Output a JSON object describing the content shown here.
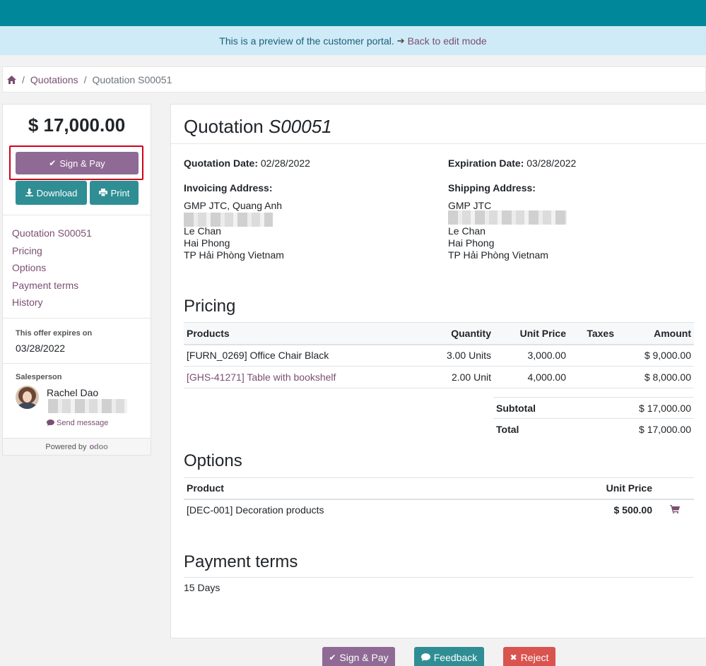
{
  "preview": {
    "message": "This is a preview of the customer portal.",
    "back_link": "Back to edit mode"
  },
  "breadcrumb": {
    "items": [
      "Quotations",
      "Quotation S00051"
    ]
  },
  "sidebar": {
    "amount": "$ 17,000.00",
    "sign_pay": "Sign & Pay",
    "download": "Download",
    "print": "Print",
    "nav": [
      "Quotation S00051",
      "Pricing",
      "Options",
      "Payment terms",
      "History"
    ],
    "expires_label": "This offer expires on",
    "expires_date": "03/28/2022",
    "salesperson_label": "Salesperson",
    "salesperson_name": "Rachel Dao",
    "send_message": "Send message",
    "powered_by": "Powered by",
    "odoo_o": "o",
    "odoo_rest": "doo"
  },
  "quotation": {
    "title_prefix": "Quotation",
    "number": "S00051",
    "date_label": "Quotation Date:",
    "date_value": "02/28/2022",
    "expiration_label": "Expiration Date:",
    "expiration_value": "03/28/2022",
    "invoicing_label": "Invoicing Address:",
    "invoicing_name": "GMP JTC, Quang Anh",
    "invoicing_lines": [
      "Le Chan",
      "Hai Phong",
      "TP Hải Phòng Vietnam"
    ],
    "shipping_label": "Shipping Address:",
    "shipping_name": "GMP JTC",
    "shipping_lines": [
      "Le Chan",
      "Hai Phong",
      "TP Hải Phòng Vietnam"
    ]
  },
  "pricing": {
    "heading": "Pricing",
    "columns": [
      "Products",
      "Quantity",
      "Unit Price",
      "Taxes",
      "Amount"
    ],
    "rows": [
      {
        "product": "[FURN_0269] Office Chair Black",
        "quantity": "3.00 Units",
        "unit_price": "3,000.00",
        "taxes": "",
        "amount": "$ 9,000.00"
      },
      {
        "product": "[GHS-41271] Table with bookshelf",
        "quantity": "2.00 Unit",
        "unit_price": "4,000.00",
        "taxes": "",
        "amount": "$ 8,000.00"
      }
    ],
    "subtotal_label": "Subtotal",
    "subtotal_value": "$ 17,000.00",
    "total_label": "Total",
    "total_value": "$ 17,000.00"
  },
  "options": {
    "heading": "Options",
    "columns": [
      "Product",
      "Unit Price"
    ],
    "rows": [
      {
        "product": "[DEC-001] Decoration products",
        "unit_price": "$ 500.00"
      }
    ]
  },
  "payment_terms": {
    "heading": "Payment terms",
    "value": "15 Days"
  },
  "actions": {
    "sign_pay": "Sign & Pay",
    "feedback": "Feedback",
    "reject": "Reject"
  },
  "colors": {
    "topbar": "#00889a",
    "primary": "#8f6a95",
    "teal": "#2f8e94",
    "danger": "#d9534f",
    "link": "#7a4f72"
  }
}
